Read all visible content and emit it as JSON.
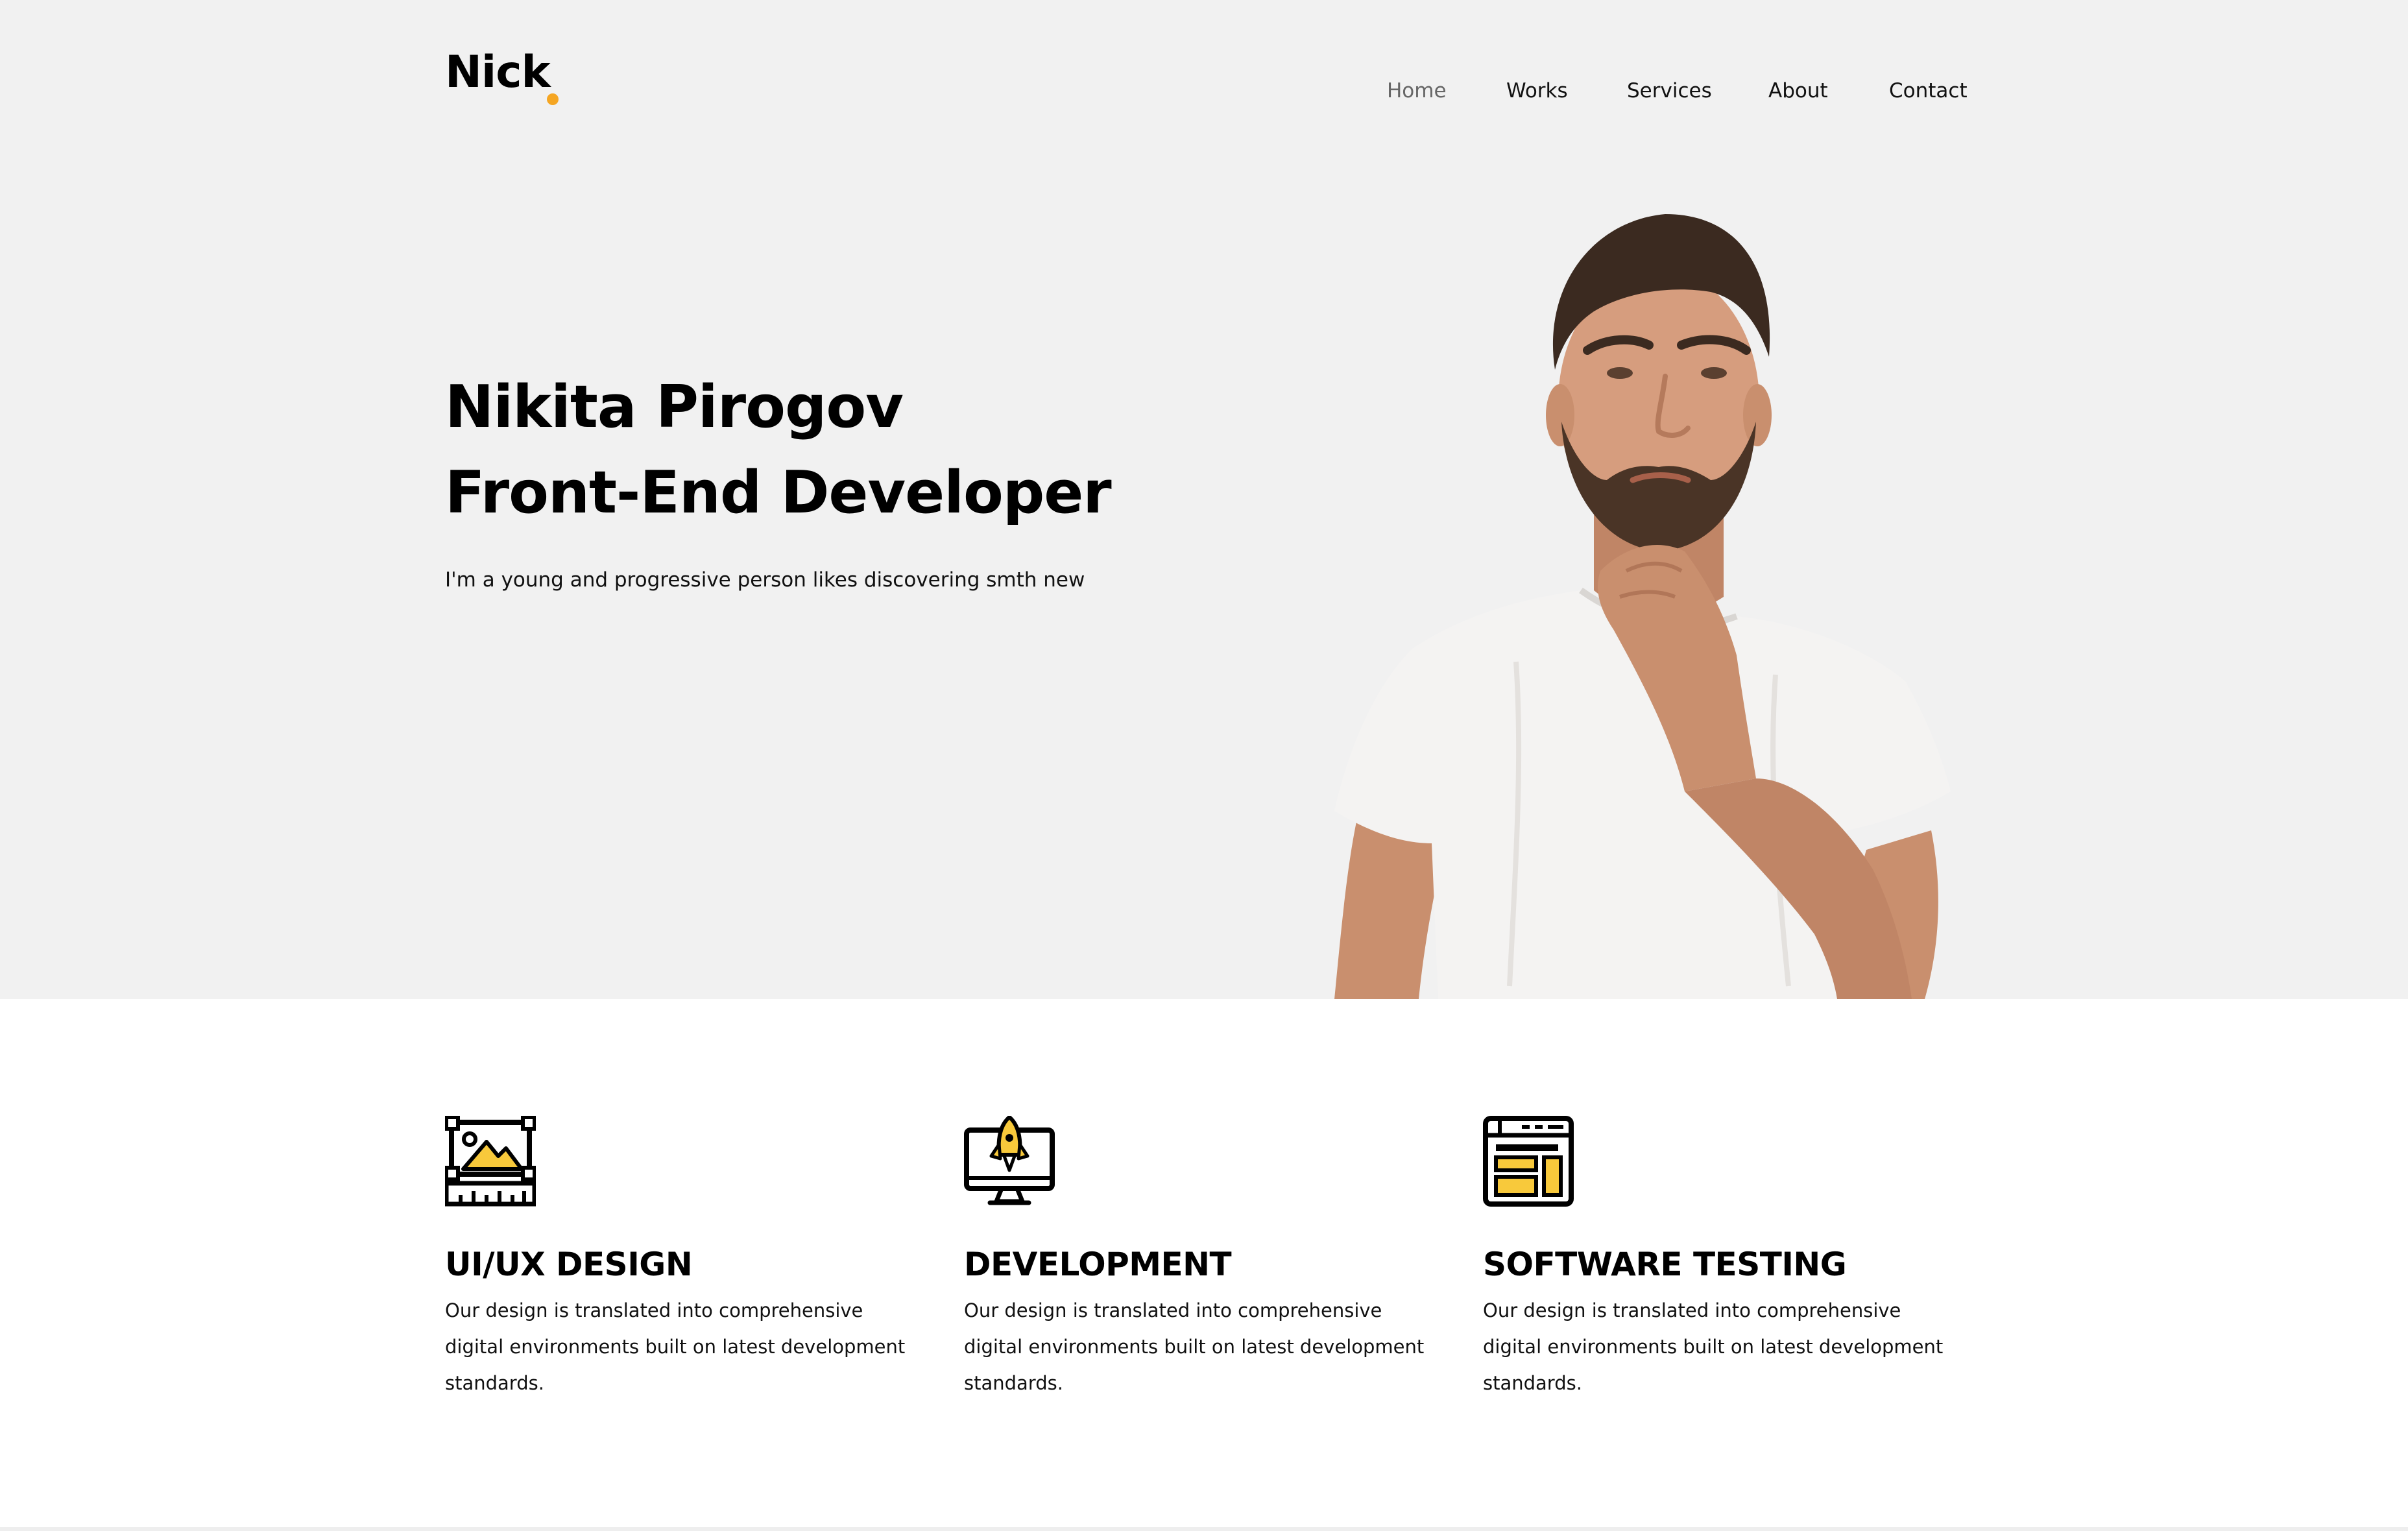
{
  "brand": {
    "name": "Nick",
    "accent": "#f5a623"
  },
  "nav": {
    "items": [
      {
        "label": "Home",
        "active": true
      },
      {
        "label": "Works",
        "active": false
      },
      {
        "label": "Services",
        "active": false
      },
      {
        "label": "About",
        "active": false
      },
      {
        "label": "Contact",
        "active": false
      }
    ]
  },
  "hero": {
    "name": "Nikita Pirogov",
    "role": "Front-End Developer",
    "subtitle": "I'm a young and progressive person likes discovering smth new"
  },
  "services": [
    {
      "icon": "design-frame-icon",
      "title": "UI/UX DESIGN",
      "text": "Our design is translated into comprehensive digital environments built on latest development standards."
    },
    {
      "icon": "monitor-rocket-icon",
      "title": "DEVELOPMENT",
      "text": "Our design is translated into comprehensive digital environments built on latest development standards."
    },
    {
      "icon": "browser-layout-icon",
      "title": "SOFTWARE TESTING",
      "text": "Our design is translated into comprehensive digital environments built on latest development standards."
    }
  ],
  "colors": {
    "hero_bg": "#f1f1f1",
    "icon_fill": "#f8c93b",
    "text": "#111111"
  }
}
